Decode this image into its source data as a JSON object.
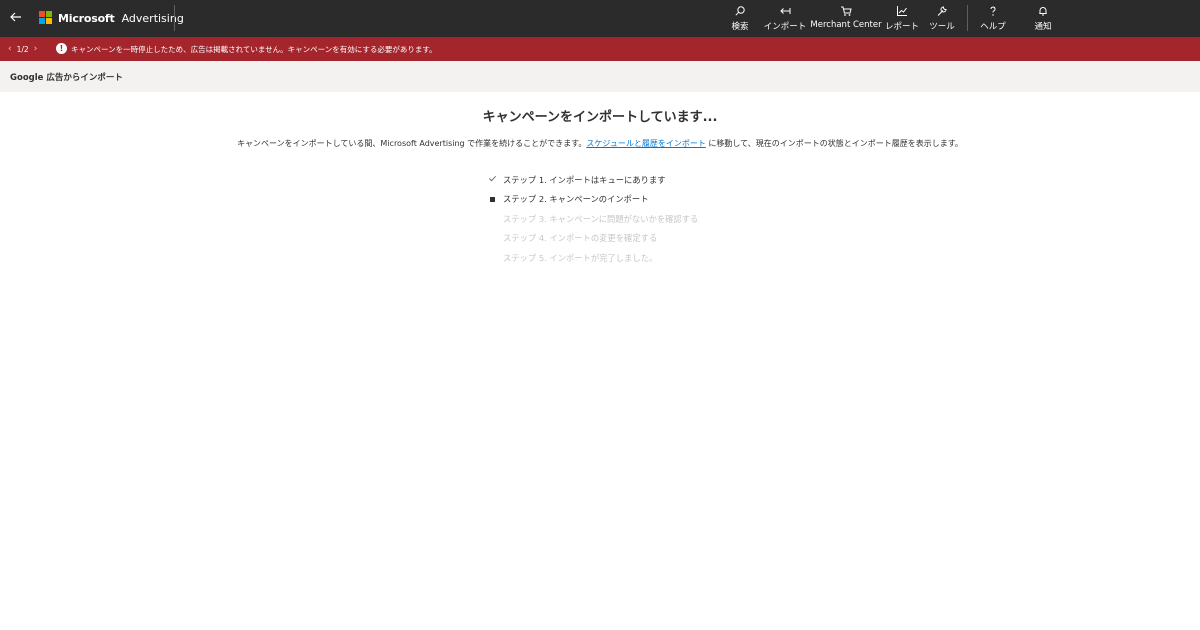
{
  "topbar": {
    "brand_microsoft": "Microsoft",
    "brand_advertising": "Advertising",
    "nav": [
      {
        "label": "検索",
        "icon": "search-icon"
      },
      {
        "label": "インポート",
        "icon": "import-icon"
      },
      {
        "label": "Merchant Center",
        "icon": "cart-icon"
      },
      {
        "label": "レポート",
        "icon": "chart-icon"
      },
      {
        "label": "ツール",
        "icon": "wrench-icon"
      },
      {
        "label": "ヘルプ",
        "icon": "help-icon"
      },
      {
        "label": "通知",
        "icon": "bell-icon"
      }
    ],
    "colors": {
      "background": "#2b2b2b",
      "logo": [
        "#f25022",
        "#7fba00",
        "#00a4ef",
        "#ffb900"
      ]
    }
  },
  "alert": {
    "pager": "1/2",
    "icon": "exclamation-icon",
    "text": "キャンペーンを一時停止したため、広告は掲載されていません。キャンペーンを有効にする必要があります。",
    "color": "#a4262c"
  },
  "subheader": {
    "title": "Google 広告からインポート"
  },
  "main": {
    "title": "キャンペーンをインポートしています...",
    "description_before": "キャンペーンをインポートしている間、Microsoft Advertising で作業を続けることができます。",
    "description_link": "スケジュールと履歴をインポート",
    "description_after": " に移動して、現在のインポートの状態とインポート履歴を表示します。",
    "steps": [
      {
        "label": "ステップ 1. インポートはキューにあります",
        "status": "done",
        "icon": "checkmark-icon"
      },
      {
        "label": "ステップ 2. キャンペーンのインポート",
        "status": "in-progress",
        "icon": "square-icon"
      },
      {
        "label": "ステップ 3. キャンペーンに問題がないかを確認する",
        "status": "pending"
      },
      {
        "label": "ステップ 4. インポートの変更を確定する",
        "status": "pending"
      },
      {
        "label": "ステップ 5. インポートが完了しました。",
        "status": "pending"
      }
    ]
  }
}
